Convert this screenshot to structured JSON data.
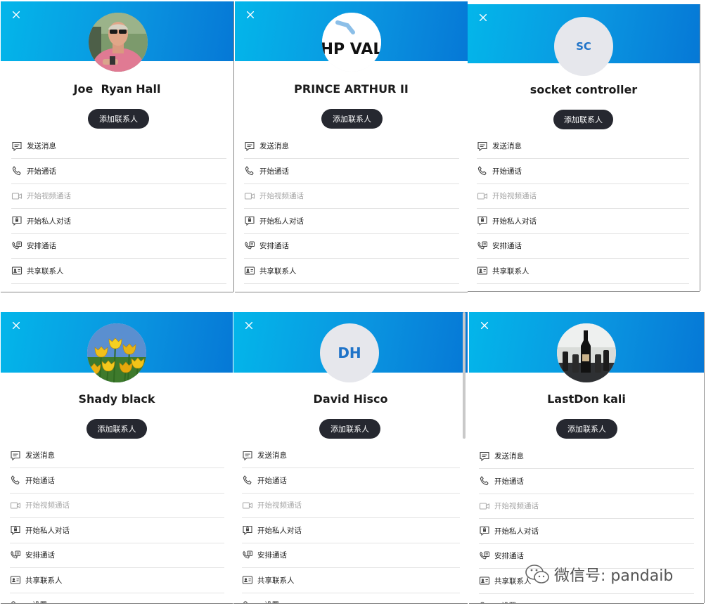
{
  "add_contact_label": "添加联系人",
  "menu_labels": [
    "发送消息",
    "开始通话",
    "开始视频通话",
    "开始私人对话",
    "安排通话",
    "共享联系人",
    "...设置"
  ],
  "colors": {
    "header_gradient_start": "#03b6ea",
    "header_gradient_end": "#0678d6",
    "button_bg": "#262830",
    "initials_color": "#1f73c8"
  },
  "panels": [
    {
      "name": "Joe  Ryan Hall",
      "avatar_type": "photo",
      "avatar_desc": "man-in-pink-shirt",
      "initials": ""
    },
    {
      "name": "PRINCE ARTHUR II",
      "avatar_type": "logo",
      "avatar_text": "HP VAL",
      "initials": ""
    },
    {
      "name": "socket controller",
      "avatar_type": "initials",
      "initials": "SC"
    },
    {
      "name": "Shady black",
      "avatar_type": "photo",
      "avatar_desc": "yellow-tulips",
      "initials": ""
    },
    {
      "name": "David Hisco",
      "avatar_type": "initials",
      "initials": "DH"
    },
    {
      "name": "LastDon kali",
      "avatar_type": "photo",
      "avatar_desc": "champagne-bottles",
      "initials": ""
    }
  ],
  "watermark": {
    "text": "微信号: pandaib",
    "icon": "wechat-icon"
  }
}
